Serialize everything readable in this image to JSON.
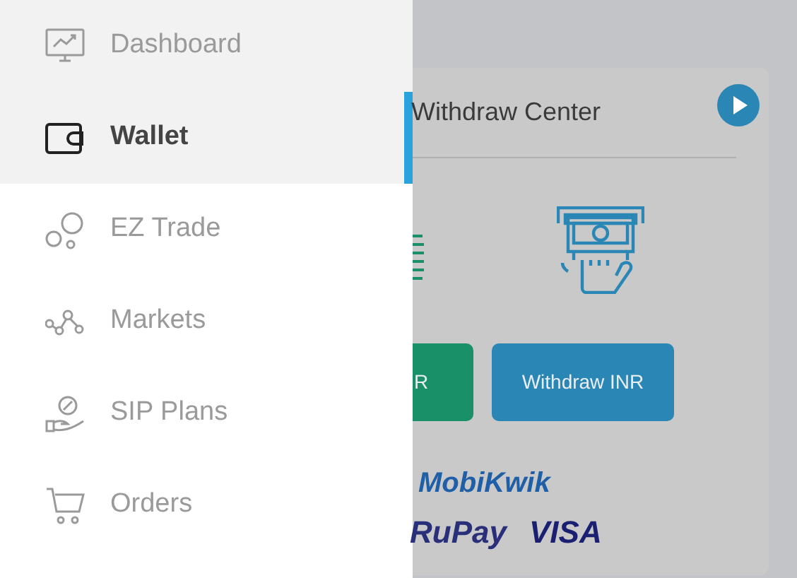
{
  "sidebar": {
    "items": [
      {
        "label": "Dashboard",
        "kind": "dashboard",
        "selected": false,
        "highlighted": true
      },
      {
        "label": "Wallet",
        "kind": "wallet",
        "selected": true,
        "highlighted": true
      },
      {
        "label": "EZ Trade",
        "kind": "bubbles",
        "selected": false,
        "highlighted": false
      },
      {
        "label": "Markets",
        "kind": "markets",
        "selected": false,
        "highlighted": false
      },
      {
        "label": "SIP Plans",
        "kind": "sip",
        "selected": false,
        "highlighted": false
      },
      {
        "label": "Orders",
        "kind": "cart",
        "selected": false,
        "highlighted": false
      }
    ]
  },
  "card": {
    "title": "Withdraw Center",
    "buttons": [
      {
        "label": "R",
        "kind": "deposit"
      },
      {
        "label": "Withdraw INR",
        "kind": "withdraw"
      }
    ],
    "payment_logos": [
      {
        "label": "MobiKwik",
        "kind": "mobikwik"
      },
      {
        "label": "RuPay",
        "kind": "rupay"
      },
      {
        "label": "VISA",
        "kind": "visa"
      }
    ]
  }
}
